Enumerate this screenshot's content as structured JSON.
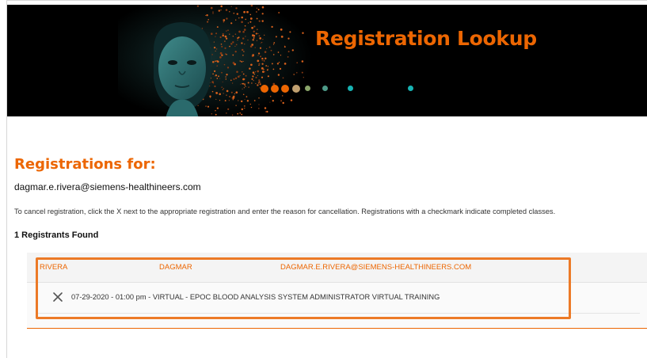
{
  "banner": {
    "title": "Registration Lookup",
    "dot_colors": [
      "#ec6602",
      "#ec6602",
      "#ec6602",
      "#c0a070",
      "#8aa56a",
      "#4d9a88",
      "#17b3b3",
      "#17b3b3"
    ]
  },
  "page": {
    "section_title": "Registrations for:",
    "user_email": "dagmar.e.rivera@siemens-healthineers.com",
    "instructions": "To cancel registration, click the X next to the appropriate registration and enter the reason for cancellation. Registrations with a checkmark indicate completed classes.",
    "found_label": "1 Registrants Found"
  },
  "registrant": {
    "last_name": "RIVERA",
    "first_name": "DAGMAR",
    "email": "DAGMAR.E.RIVERA@SIEMENS-HEALTHINEERS.COM",
    "courses": [
      {
        "cancel_icon": "close-icon",
        "text": "07-29-2020 - 01:00 pm - VIRTUAL - EPOC BLOOD ANALYSIS SYSTEM ADMINISTRATOR VIRTUAL TRAINING"
      }
    ]
  },
  "colors": {
    "accent": "#ec6602",
    "highlight": "#ec7a27",
    "teal": "#17b3b3"
  }
}
